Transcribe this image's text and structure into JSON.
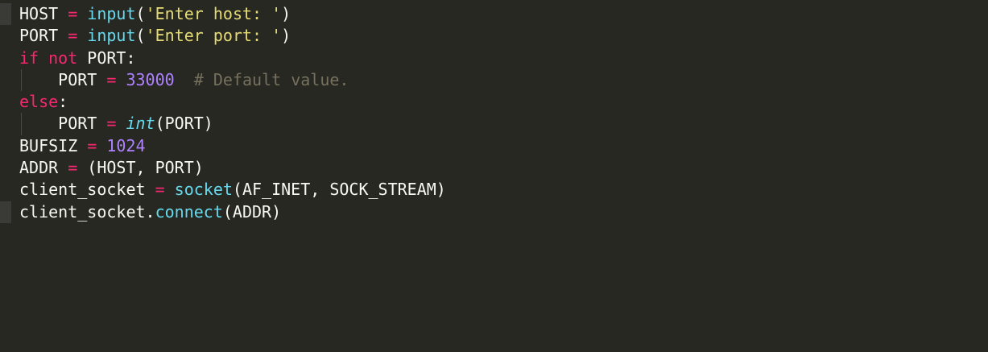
{
  "code": {
    "lines": [
      [
        {
          "t": "id",
          "v": "HOST "
        },
        {
          "t": "op",
          "v": "="
        },
        {
          "t": "id",
          "v": " "
        },
        {
          "t": "fn",
          "v": "input"
        },
        {
          "t": "punc",
          "v": "("
        },
        {
          "t": "str",
          "v": "'Enter host: '"
        },
        {
          "t": "punc",
          "v": ")"
        }
      ],
      [
        {
          "t": "id",
          "v": "PORT "
        },
        {
          "t": "op",
          "v": "="
        },
        {
          "t": "id",
          "v": " "
        },
        {
          "t": "fn",
          "v": "input"
        },
        {
          "t": "punc",
          "v": "("
        },
        {
          "t": "str",
          "v": "'Enter port: '"
        },
        {
          "t": "punc",
          "v": ")"
        }
      ],
      [
        {
          "t": "kw",
          "v": "if"
        },
        {
          "t": "id",
          "v": " "
        },
        {
          "t": "kw",
          "v": "not"
        },
        {
          "t": "id",
          "v": " PORT:"
        }
      ],
      [
        {
          "t": "id",
          "v": "    PORT "
        },
        {
          "t": "op",
          "v": "="
        },
        {
          "t": "id",
          "v": " "
        },
        {
          "t": "num",
          "v": "33000"
        },
        {
          "t": "id",
          "v": "  "
        },
        {
          "t": "cm",
          "v": "# Default value."
        }
      ],
      [
        {
          "t": "kw",
          "v": "else"
        },
        {
          "t": "punc",
          "v": ":"
        }
      ],
      [
        {
          "t": "id",
          "v": "    PORT "
        },
        {
          "t": "op",
          "v": "="
        },
        {
          "t": "id",
          "v": " "
        },
        {
          "t": "bi",
          "v": "int"
        },
        {
          "t": "punc",
          "v": "(PORT)"
        }
      ],
      [
        {
          "t": "id",
          "v": "BUFSIZ "
        },
        {
          "t": "op",
          "v": "="
        },
        {
          "t": "id",
          "v": " "
        },
        {
          "t": "num",
          "v": "1024"
        }
      ],
      [
        {
          "t": "id",
          "v": "ADDR "
        },
        {
          "t": "op",
          "v": "="
        },
        {
          "t": "id",
          "v": " (HOST, PORT)"
        }
      ],
      [
        {
          "t": "id",
          "v": "client_socket "
        },
        {
          "t": "op",
          "v": "="
        },
        {
          "t": "id",
          "v": " "
        },
        {
          "t": "fn",
          "v": "socket"
        },
        {
          "t": "punc",
          "v": "(AF_INET, SOCK_STREAM)"
        }
      ],
      [
        {
          "t": "id",
          "v": "client_socket."
        },
        {
          "t": "meth",
          "v": "connect"
        },
        {
          "t": "punc",
          "v": "(ADDR)"
        }
      ]
    ],
    "indented_lines": [
      3,
      5
    ],
    "marked_lines": [
      0,
      9
    ]
  },
  "theme": {
    "background": "#272822",
    "foreground": "#f8f8f2",
    "keyword": "#f92672",
    "function": "#66d9ef",
    "string": "#e6db74",
    "number": "#ae81ff",
    "comment": "#75715e"
  }
}
